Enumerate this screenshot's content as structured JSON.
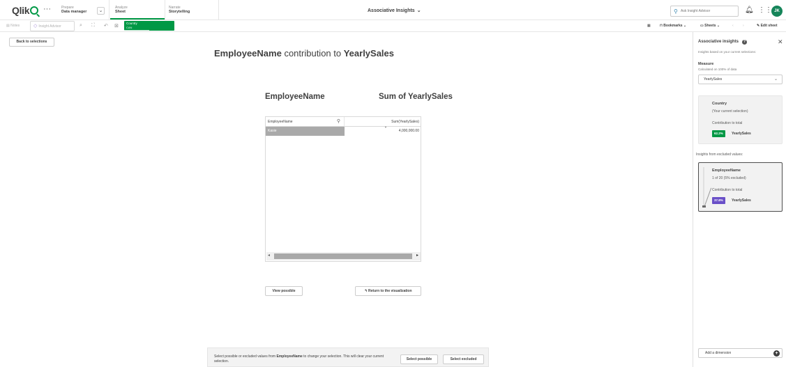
{
  "app": {
    "logo_text": "Qlik",
    "more_label": "···",
    "nav": [
      {
        "top": "Prepare",
        "bottom": "Data manager"
      },
      {
        "top": "Analyze",
        "bottom": "Sheet"
      },
      {
        "top": "Narrate",
        "bottom": "Storytelling"
      }
    ],
    "sheet_title": "Associative Insights",
    "search_placeholder": "Ask Insight Advisor",
    "avatar_initials": "JK"
  },
  "toolbar": {
    "notes_label": "Notes",
    "insight_label": "Insight Advisor",
    "selection": {
      "field": "Country",
      "value": "CAN"
    },
    "bookmarks_label": "Bookmarks",
    "sheets_label": "Sheets",
    "edit_label": "Edit sheet"
  },
  "main": {
    "back_label": "Back to selections",
    "title_dimension": "EmployeeName",
    "title_mid": " contribution to ",
    "title_measure": "YearlySales",
    "col_dimension": "EmployeeName",
    "col_measure": "Sum of YearlySales",
    "table": {
      "headers": [
        "EmployeeName",
        "Sum(YearlySales)"
      ],
      "rows": [
        {
          "name": "Kasie",
          "value": "4,000,000.00"
        }
      ]
    },
    "view_possible_label": "View possible",
    "return_label": "Return to the visualization",
    "footer_msg_a": "Select possible or excluded values from ",
    "footer_msg_field": "EmployeeName",
    "footer_msg_b": " to change your selection. This will clear your current selection.",
    "select_possible_label": "Select possible",
    "select_excluded_label": "Select excluded"
  },
  "panel": {
    "title": "Associative insights",
    "subtitle": "Insights based on your current selections:",
    "measure_label": "Measure",
    "measure_calc": "Calculated on 100% of data",
    "measure_value": "YearlySales",
    "card1": {
      "title": "Country",
      "sub": "(Your current selection)",
      "contribution_label": "Contribution to total",
      "badge": "62.2%",
      "badge_measure": "YearlySales",
      "badge_color": "#009845"
    },
    "excluded_heading": "Insights from excluded values:",
    "card2": {
      "title": "EmployeeName",
      "sub": "1 of 20 (5% excluded)",
      "contribution_label": "Contribution to total",
      "badge": "37.8%",
      "badge_measure": "YearlySales",
      "badge_color": "#6a50c8"
    },
    "add_dimension_label": "Add a dimension"
  },
  "colors": {
    "accent": "#009845",
    "avatar": "#16855a",
    "excluded_badge": "#6a50c8"
  }
}
